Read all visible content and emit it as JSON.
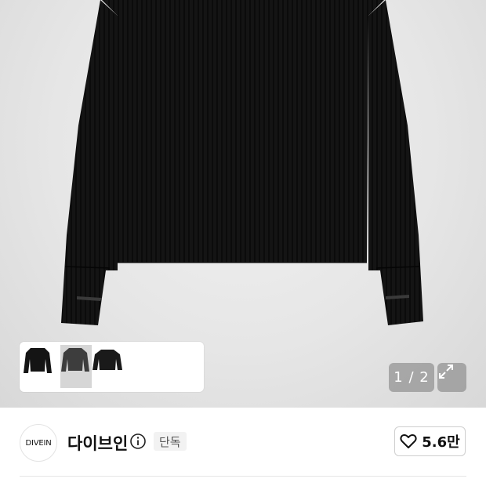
{
  "gallery": {
    "pager_text": "1 / 2",
    "thumbnails": [
      {
        "label": "black-top-front",
        "color": "#151515"
      },
      {
        "label": "charcoal-top",
        "color": "#3c3c3c"
      },
      {
        "label": "black-top-relaxed",
        "color": "#1a1a1a"
      }
    ],
    "selected_thumbnail": 1
  },
  "brand": {
    "logo_text": "DIVEIN",
    "name": "다이브인",
    "badge": "단독",
    "info_icon": "info-icon"
  },
  "like": {
    "icon": "heart-icon",
    "count": "5.6만"
  },
  "colors": {
    "garment": "#121212",
    "hero_bg": "#e6e6e6",
    "pager_bg": "#8a8a8a"
  }
}
